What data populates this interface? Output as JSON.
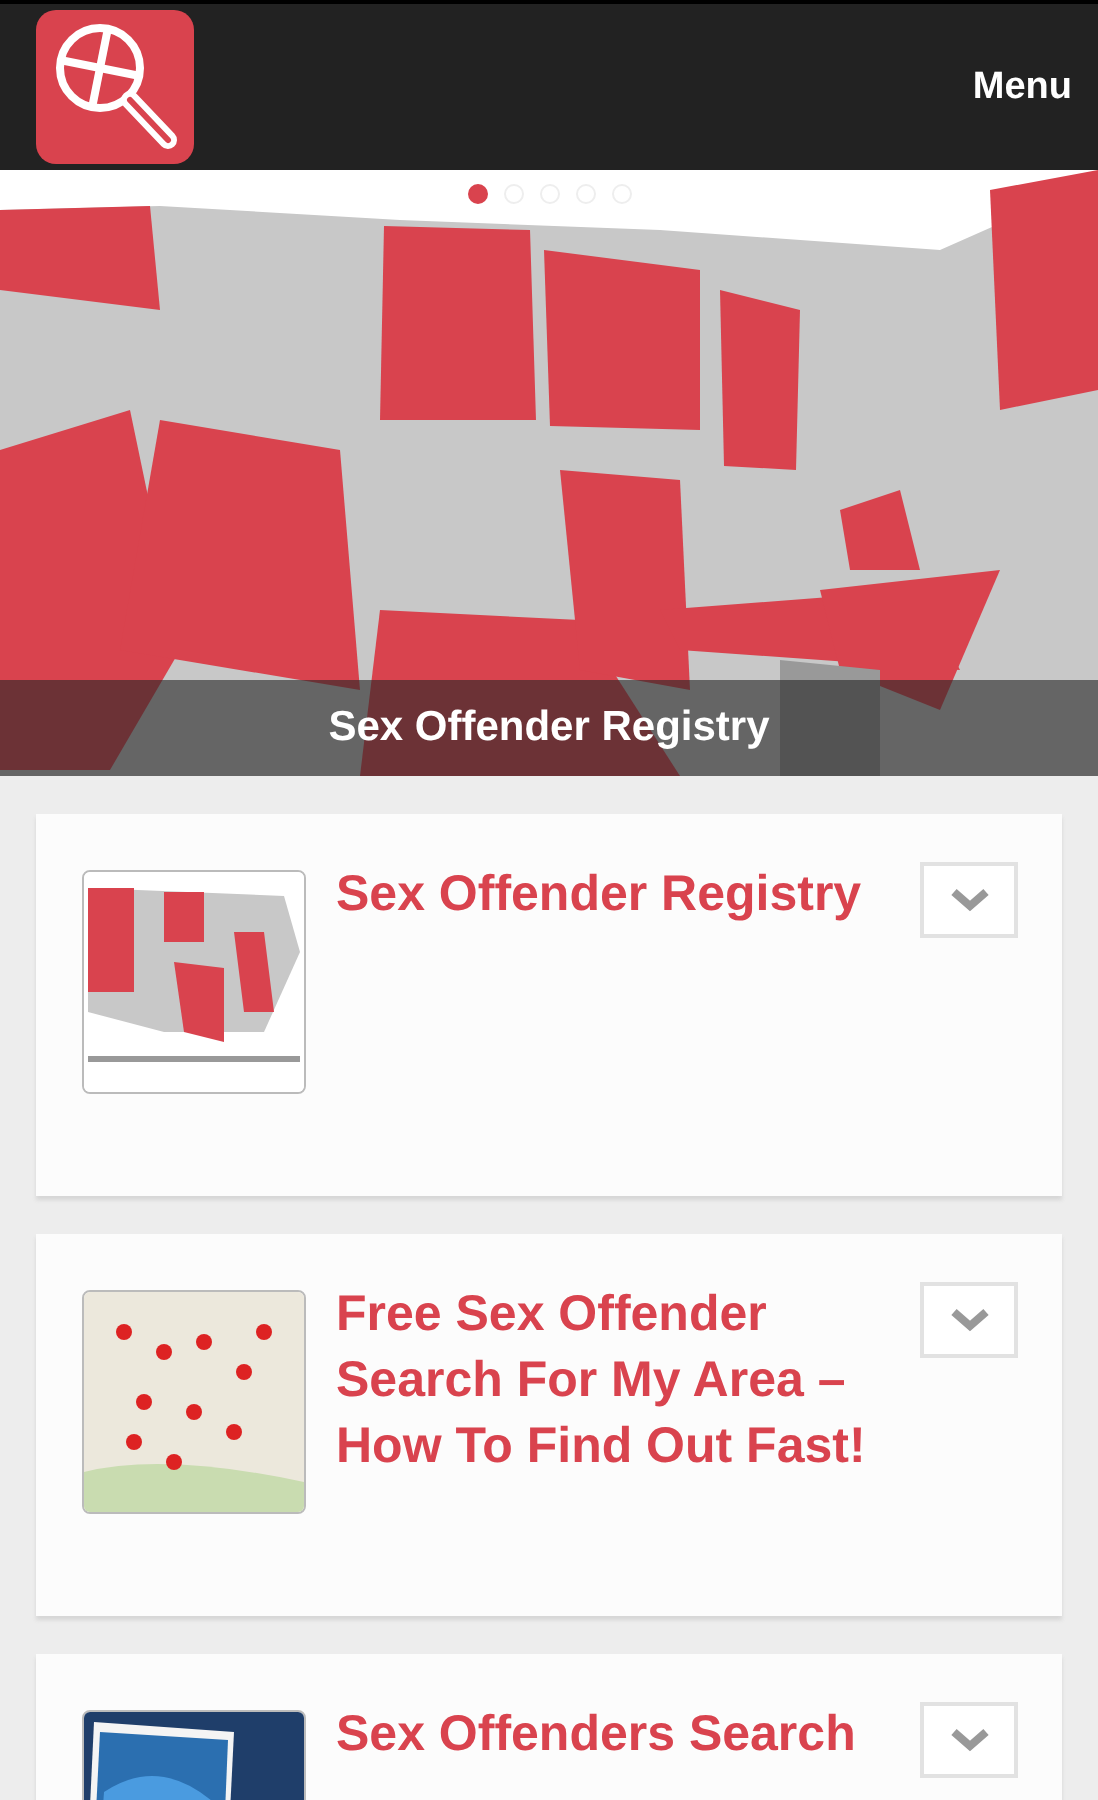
{
  "header": {
    "menu_label": "Menu"
  },
  "slider": {
    "caption": "Sex Offender Registry",
    "dots": [
      {
        "selected": true
      },
      {
        "selected": false
      },
      {
        "selected": false
      },
      {
        "selected": false
      },
      {
        "selected": false
      }
    ]
  },
  "articles": [
    {
      "title": "Sex Offender Registry"
    },
    {
      "title": "Free Sex Offender Search For My Area – How To Find Out Fast!"
    },
    {
      "title": "Sex Offenders Search"
    }
  ]
}
